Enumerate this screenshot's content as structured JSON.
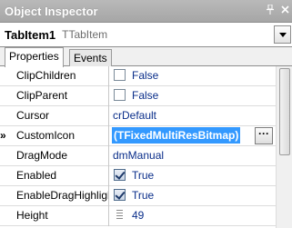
{
  "window": {
    "title": "Object Inspector",
    "pin_icon": "pin-icon",
    "close_icon": "close-icon"
  },
  "selector": {
    "object_name": "TabItem1",
    "object_class": "TTabItem"
  },
  "tabs": [
    {
      "label": "Properties",
      "active": true
    },
    {
      "label": "Events",
      "active": false
    }
  ],
  "properties": [
    {
      "name": "ClipChildren",
      "type": "bool",
      "checked": false,
      "value": "False"
    },
    {
      "name": "ClipParent",
      "type": "bool",
      "checked": false,
      "value": "False"
    },
    {
      "name": "Cursor",
      "type": "text",
      "value": "crDefault"
    },
    {
      "name": "CustomIcon",
      "type": "object",
      "value": "(TFixedMultiResBitmap)",
      "selected": true,
      "marker": "»",
      "button": "···"
    },
    {
      "name": "DragMode",
      "type": "text",
      "value": "dmManual"
    },
    {
      "name": "Enabled",
      "type": "bool",
      "checked": true,
      "value": "True"
    },
    {
      "name": "EnableDragHighlight",
      "type": "bool",
      "checked": true,
      "value": "True"
    },
    {
      "name": "Height",
      "type": "number",
      "value": "49"
    }
  ],
  "colors": {
    "selection": "#3399ff",
    "value_text": "#0a2e8a",
    "title_bar": "#a6a6a6"
  }
}
